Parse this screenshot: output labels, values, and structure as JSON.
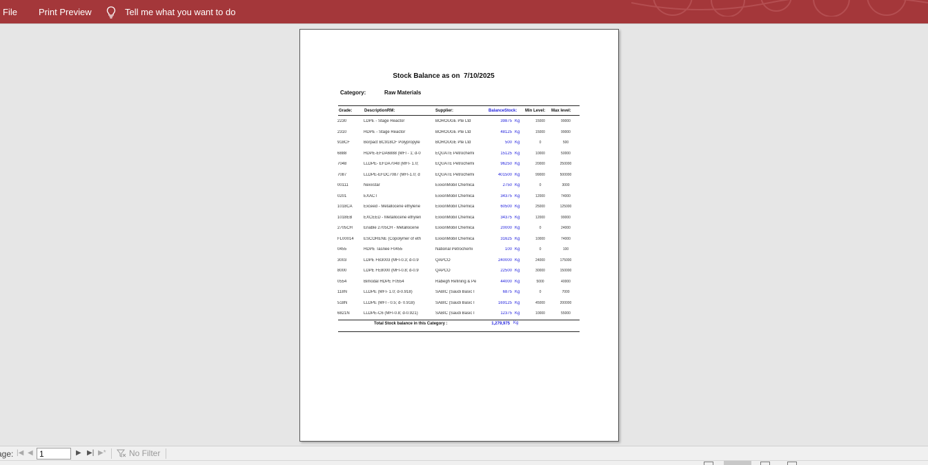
{
  "ribbon": {
    "file_label": "File",
    "print_preview_label": "Print Preview",
    "tell_me_label": "Tell me what you want to do",
    "accent_color": "#a4373a"
  },
  "report": {
    "title": "Stock Balance as on  7/10/2025",
    "category_label": "Category:",
    "category_value": "Raw Materials",
    "headers": {
      "grade": "Grade:",
      "description": "DescriptionRM:",
      "supplier": "Supplier:",
      "balance": "BalanceStock:",
      "min": "Min Level:",
      "max": "Max level:"
    },
    "rows": [
      {
        "grade": "2230",
        "description": "LDPE -  Stage Reactor",
        "supplier": "BOROUGE Pte Ltd",
        "balance": "39875",
        "unit": "Kg",
        "min": "15000",
        "max": "99000"
      },
      {
        "grade": "2310",
        "description": "HDPE -  Stage Reactor",
        "supplier": "BOROUGE Pte Ltd",
        "balance": "48125",
        "unit": "Kg",
        "min": "15000",
        "max": "99000"
      },
      {
        "grade": "918CF",
        "description": "Borpact BC918CF Polypropyle",
        "supplier": "BOROUGE Pte Ltd",
        "balance": "500",
        "unit": "Kg",
        "min": "0",
        "max": "500"
      },
      {
        "grade": "6888",
        "description": "HDPE-EFDA6888 (MFI - 1; d-0",
        "supplier": "EQUATE Petrochemi",
        "balance": "15125",
        "unit": "Kg",
        "min": "10000",
        "max": "50000"
      },
      {
        "grade": "7048",
        "description": "LLDPE- EFDA7048 (MFI- 1.0;",
        "supplier": "EQUATE Petrochemi",
        "balance": "96250",
        "unit": "Kg",
        "min": "20000",
        "max": "250000"
      },
      {
        "grade": "7087",
        "description": "LLDPE-EFDC7087 (MFI-1.0; d",
        "supplier": "EQUATE Petrochemi",
        "balance": "401500",
        "unit": "Kg",
        "min": "99000",
        "max": "500000"
      },
      {
        "grade": "00111",
        "description": "Nexxstar",
        "supplier": "ExxonMobil Chemica",
        "balance": "2750",
        "unit": "Kg",
        "min": "0",
        "max": "3000"
      },
      {
        "grade": "0201",
        "description": "EXACT",
        "supplier": "ExxonMobil Chemica",
        "balance": "34375",
        "unit": "Kg",
        "min": "12000",
        "max": "74000"
      },
      {
        "grade": "1018CA",
        "description": "Exceed - Metallocene ethylene",
        "supplier": "ExxonMobil Chemica",
        "balance": "60500",
        "unit": "Kg",
        "min": "25000",
        "max": "125000"
      },
      {
        "grade": "1018EB",
        "description": "EXCEED - Metallocene ethylen",
        "supplier": "ExxonMobil Chemica",
        "balance": "34375",
        "unit": "Kg",
        "min": "12000",
        "max": "99000"
      },
      {
        "grade": "2705CH",
        "description": "Enable 2705CH - Metallocene",
        "supplier": "ExxonMobil Chemica",
        "balance": "20000",
        "unit": "Kg",
        "min": "0",
        "max": "24000"
      },
      {
        "grade": "FL00014",
        "description": "ESCORENE (Copolymer of eth",
        "supplier": "ExxonMobil Chemica",
        "balance": "31625",
        "unit": "Kg",
        "min": "10000",
        "max": "74000"
      },
      {
        "grade": "0455",
        "description": "HDPE Tasnee F0455",
        "supplier": "National Petrochemi",
        "balance": "100",
        "unit": "Kg",
        "min": "0",
        "max": "100"
      },
      {
        "grade": "3003",
        "description": "LDPE FB3003 (MFI-0.3; d-0.9",
        "supplier": "QAPCO",
        "balance": "240000",
        "unit": "Kg",
        "min": "24000",
        "max": "175000"
      },
      {
        "grade": "8000",
        "description": "LDPE FE8000 (MFI-0.8; d-0.9",
        "supplier": "QAPCO",
        "balance": "22500",
        "unit": "Kg",
        "min": "30000",
        "max": "150000"
      },
      {
        "grade": "0554",
        "description": "Bimodal HDPE F0554",
        "supplier": "Rabegh Refining & Pe",
        "balance": "44000",
        "unit": "Kg",
        "min": "5000",
        "max": "40000"
      },
      {
        "grade": "118N",
        "description": "LLDPE (MFI- 1.0; d-0.918)",
        "supplier": "SABIC (Saudi Basic I",
        "balance": "6875",
        "unit": "Kg",
        "min": "0",
        "max": "7000"
      },
      {
        "grade": "518N",
        "description": "LLDPE (MFI - 0.5; d- 0.918)",
        "supplier": "SABIC (Saudi Basic I",
        "balance": "169125",
        "unit": "Kg",
        "min": "45000",
        "max": "200000"
      },
      {
        "grade": "6821N",
        "description": "LLDPE-C6 (MFI-0.8; d-0.921)",
        "supplier": "SABIC (Saudi Basic I",
        "balance": "12375",
        "unit": "Kg",
        "min": "10000",
        "max": "55000"
      }
    ],
    "total_label": "Total Stock balance in this Category :",
    "total_value": "1,279,975",
    "total_unit": "Kg"
  },
  "navigation": {
    "page_label": "age:",
    "page_number": "1",
    "filter_label": "No Filter"
  }
}
